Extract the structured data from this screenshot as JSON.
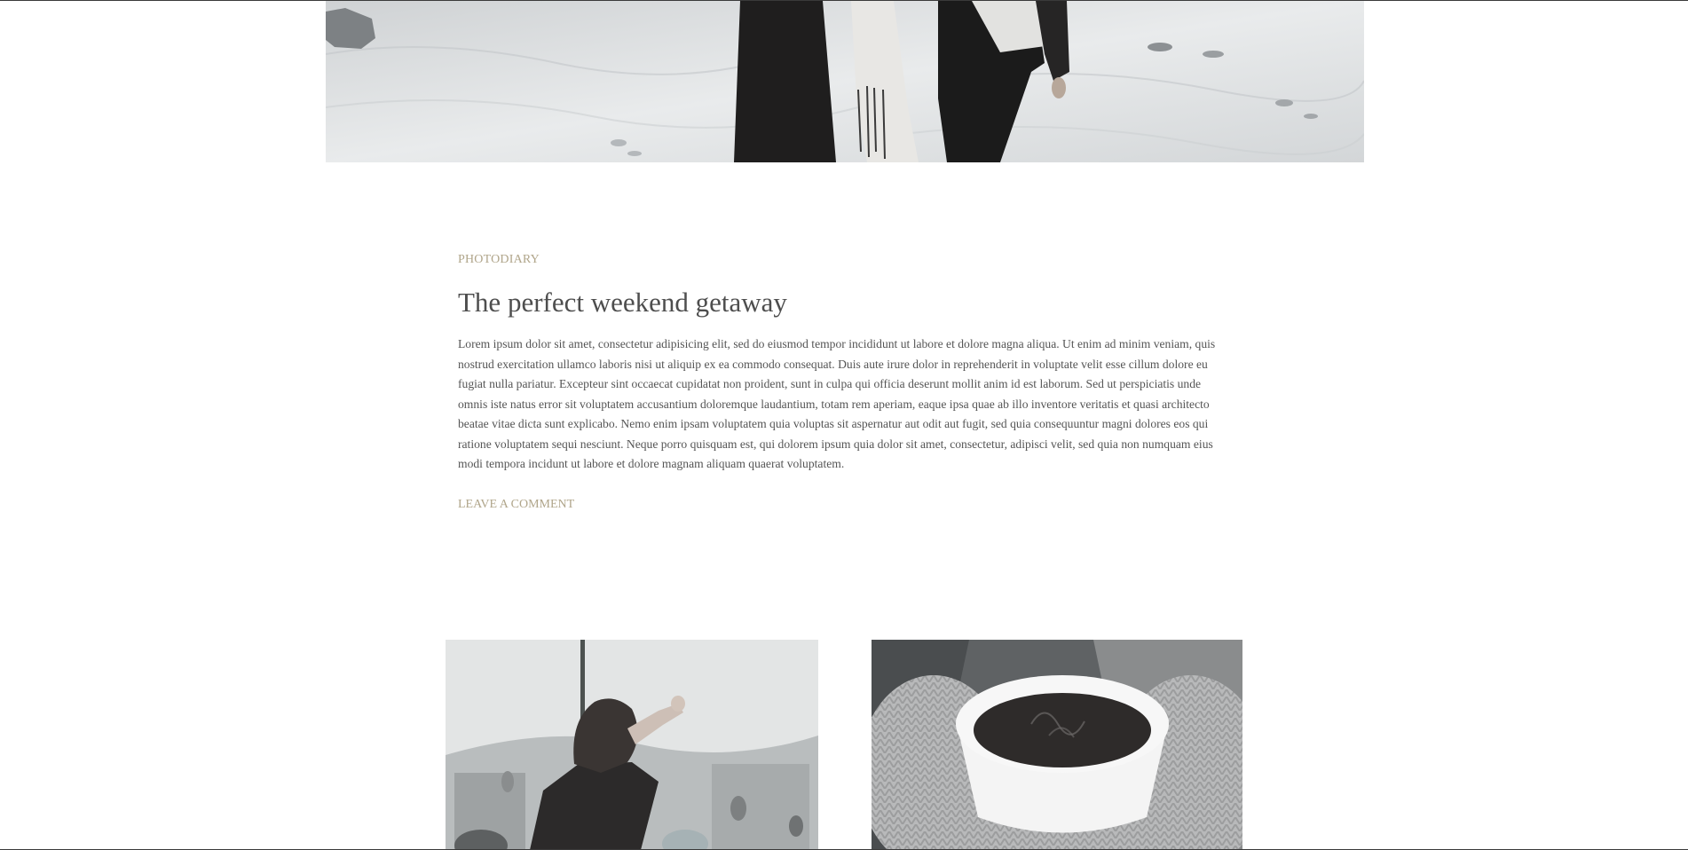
{
  "article": {
    "category": "PHOTODIARY",
    "title": "The perfect weekend getaway",
    "excerpt": "Lorem ipsum dolor sit amet, consectetur adipisicing elit, sed do eiusmod tempor incididunt ut labore et dolore magna aliqua. Ut enim ad minim veniam, quis nostrud exercitation ullamco laboris nisi ut aliquip ex ea commodo consequat. Duis aute irure dolor in reprehenderit in voluptate velit esse cillum dolore eu fugiat nulla pariatur. Excepteur sint occaecat cupidatat non proident, sunt in culpa qui officia deserunt mollit anim id est laborum. Sed ut perspiciatis unde omnis iste natus error sit voluptatem accusantium doloremque laudantium, totam rem aperiam, eaque ipsa quae ab illo inventore veritatis et quasi architecto beatae vitae dicta sunt explicabo. Nemo enim ipsam voluptatem quia voluptas sit aspernatur aut odit aut fugit, sed quia consequuntur magni dolores eos qui ratione voluptatem sequi nesciunt. Neque porro quisquam est, qui dolorem ipsum quia dolor sit amet, consectetur, adipisci velit, sed quia non numquam eius modi tempora incidunt ut labore et dolore magnam aliquam quaerat voluptatem.",
    "comment_link": "LEAVE A COMMENT"
  },
  "colors": {
    "accent": "#b0a58a",
    "title_text": "#4e4e4e",
    "body_text": "#555555",
    "background": "#ffffff"
  }
}
